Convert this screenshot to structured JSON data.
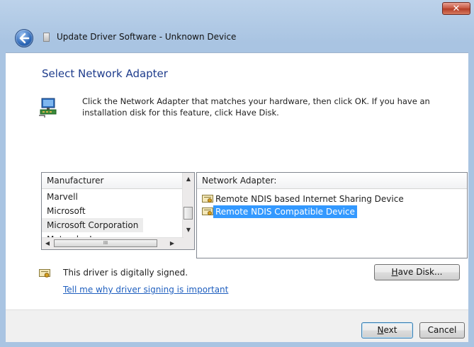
{
  "window": {
    "title": "Update Driver Software - Unknown Device",
    "close_glyph": "✕"
  },
  "page": {
    "heading": "Select Network Adapter",
    "instructions": "Click the Network Adapter that matches your hardware, then click OK. If you have an installation disk for this feature, click Have Disk."
  },
  "manufacturer_list": {
    "header": "Manufacturer",
    "items": [
      "Marvell",
      "Microsoft",
      "Microsoft Corporation",
      "Motorola, Inc."
    ],
    "selected": "Microsoft Corporation",
    "scroll_glyphs": {
      "up": "▲",
      "down": "▼",
      "left": "◀",
      "right": "▶",
      "grip": "III"
    }
  },
  "adapter_list": {
    "header": "Network Adapter:",
    "items": [
      "Remote NDIS based Internet Sharing Device",
      "Remote NDIS Compatible Device"
    ],
    "selected": "Remote NDIS Compatible Device"
  },
  "signing": {
    "status": "This driver is digitally signed.",
    "link": "Tell me why driver signing is important"
  },
  "buttons": {
    "have_disk_mnemonic": "H",
    "have_disk_rest": "ave Disk...",
    "next_mnemonic": "N",
    "next_rest": "ext",
    "cancel": "Cancel"
  },
  "colors": {
    "heading": "#1e3c8c",
    "link": "#1f5fbf",
    "selection": "#3399ff"
  }
}
